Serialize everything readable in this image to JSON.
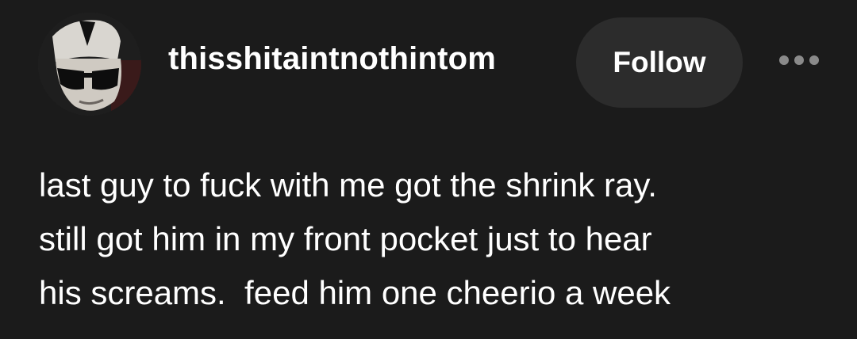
{
  "post": {
    "username": "thisshitaintnothintom",
    "follow_label": "Follow",
    "more_icon": "ellipsis-icon",
    "avatar_icon": "user-avatar",
    "body_lines": [
      "last guy to fuck with me got the shrink ray.",
      "still got him in my front pocket just to hear",
      "his screams.  feed him one cheerio a week"
    ]
  },
  "colors": {
    "background": "#1b1b1b",
    "text": "#ffffff",
    "button_bg": "#2c2c2c",
    "icon_muted": "#8a8a8a"
  }
}
